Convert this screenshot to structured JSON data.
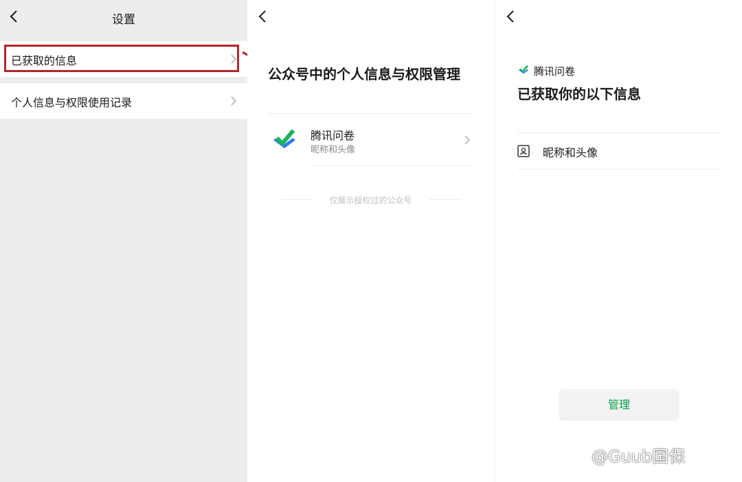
{
  "panel1": {
    "title": "设置",
    "items": [
      {
        "label": "已获取的信息"
      },
      {
        "label": "个人信息与权限使用记录"
      }
    ]
  },
  "panel2": {
    "title": "公众号中的个人信息与权限管理",
    "app": {
      "name": "腾讯问卷",
      "permission": "昵称和头像"
    },
    "note": "仅展示授权过的公众号"
  },
  "panel3": {
    "app_name": "腾讯问卷",
    "title": "已获取你的以下信息",
    "info_item": "昵称和头像",
    "manage_label": "管理"
  },
  "watermark": "@Guub国保",
  "colors": {
    "highlight": "#b3252b",
    "accent_green": "#07a04a",
    "logo_green": "#1fb35a",
    "logo_blue": "#2d7cf6"
  }
}
